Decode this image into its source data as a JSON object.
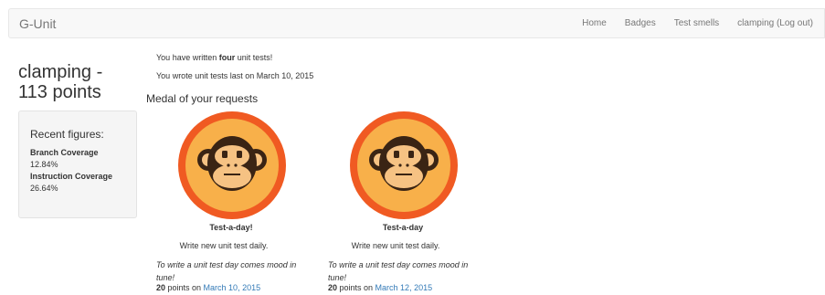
{
  "nav": {
    "brand": "G-Unit",
    "items": [
      "Home",
      "Badges",
      "Test smells",
      "clamping (Log out)"
    ]
  },
  "profile": {
    "username_line": "clamping -",
    "points_line": "113 points"
  },
  "figures": {
    "title": "Recent figures:",
    "items": [
      {
        "label": "Branch Coverage",
        "value": "12.84%"
      },
      {
        "label": "Instruction Coverage",
        "value": "26.64%"
      }
    ]
  },
  "summary": {
    "written_prefix": "You have written ",
    "written_count": "four",
    "written_suffix": " unit tests!",
    "last_written": "You wrote unit tests last on March 10, 2015"
  },
  "medals_section_title": "Medal of your requests",
  "medals": [
    {
      "title": "Test-a-day!",
      "description": "Write new unit test daily.",
      "quote": "To write a unit test day comes mood in tune!",
      "points": "20",
      "points_on": " points on ",
      "date": "March 10, 2015",
      "icon": "monkey-medal-icon"
    },
    {
      "title": "Test-a-day",
      "description": "Write new unit test daily.",
      "quote": "To write a unit test day comes mood in tune!",
      "points": "20",
      "points_on": " points on ",
      "date": "March 12, 2015",
      "icon": "monkey-medal-icon"
    }
  ],
  "colors": {
    "medal_ring": "#f05a22",
    "medal_fill": "#f8b04a",
    "monkey_face": "#f6c283",
    "monkey_ink": "#3a2414",
    "link": "#337ab7"
  }
}
